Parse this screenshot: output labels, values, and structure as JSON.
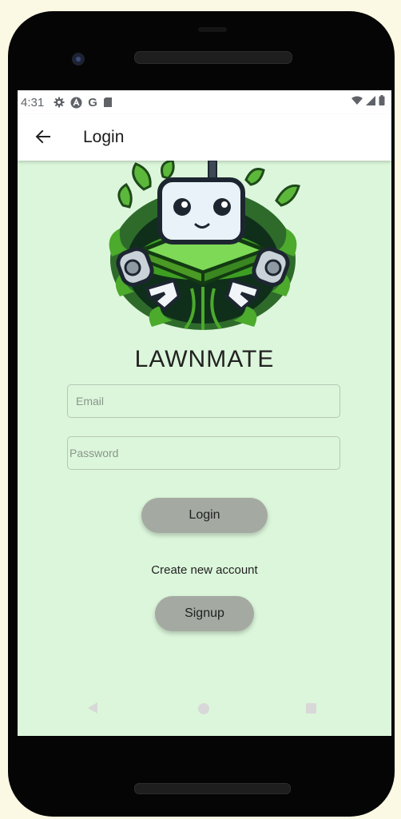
{
  "status": {
    "time": "4:31",
    "icons": [
      "settings-icon",
      "a-icon",
      "google-icon",
      "sd-card-icon"
    ],
    "right_icons": [
      "wifi-icon",
      "signal-icon",
      "battery-icon"
    ],
    "google_glyph": "G"
  },
  "appbar": {
    "title": "Login"
  },
  "brand": {
    "name": "LAWNMATE"
  },
  "form": {
    "email_placeholder": "Email",
    "password_placeholder": "Password",
    "login_label": "Login",
    "create_account_label": "Create new account",
    "signup_label": "Signup"
  },
  "colors": {
    "screen_bg": "#dcf6db",
    "button_bg": "#a4aaa2",
    "page_bg": "#fbf8e3"
  }
}
